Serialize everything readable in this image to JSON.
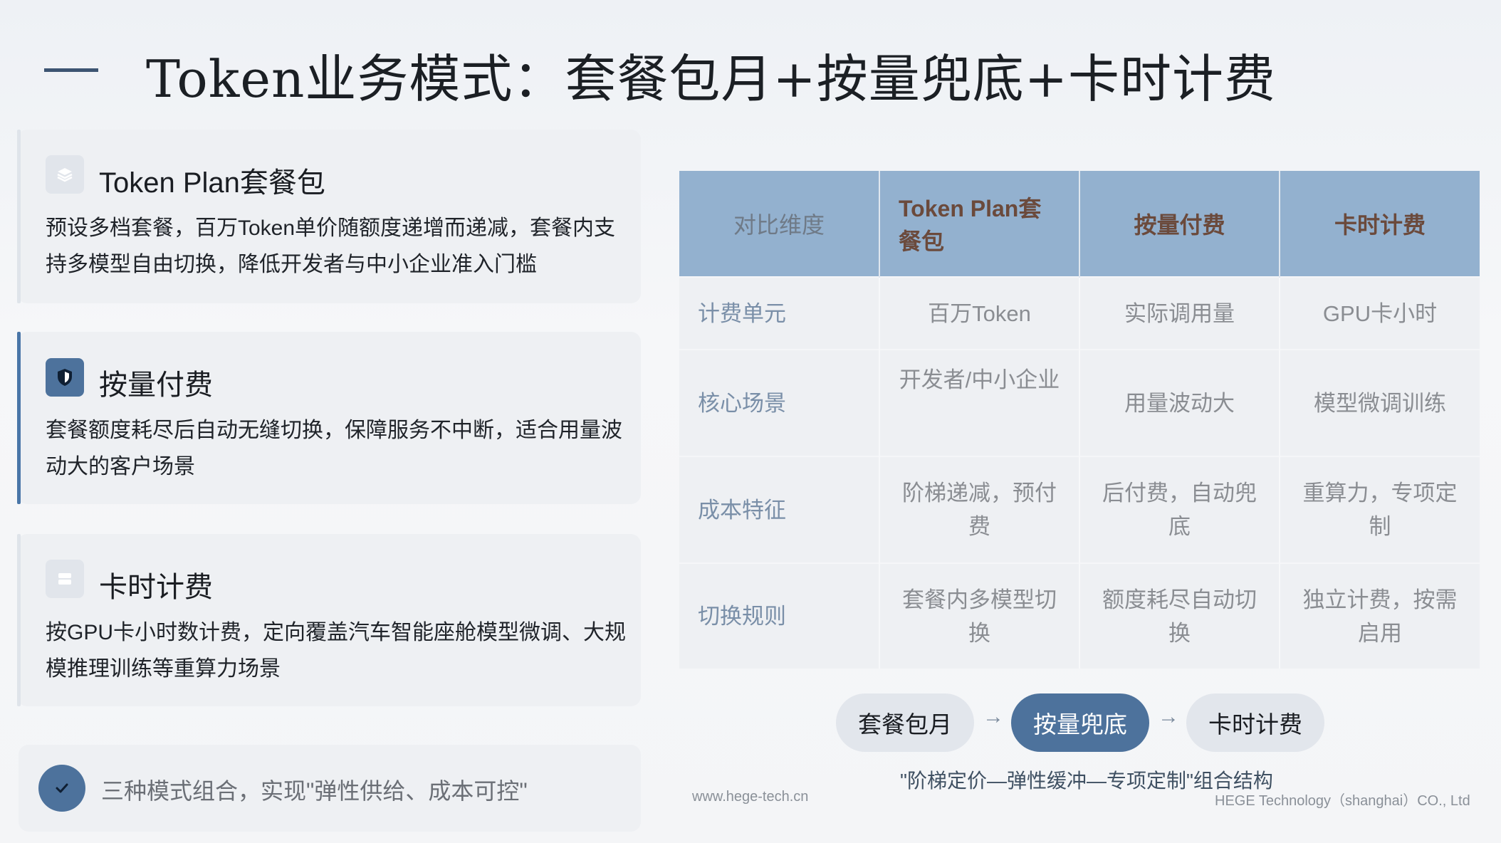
{
  "title": "Token业务模式：套餐包月+按量兜底+卡时计费",
  "cards": [
    {
      "heading": "Token Plan套餐包",
      "body": "预设多档套餐，百万Token单价随额度递增而递减，套餐内支持多模型自由切换，降低开发者与中小企业准入门槛",
      "icon": "layers-icon"
    },
    {
      "heading": "按量付费",
      "body": "套餐额度耗尽后自动无缝切换，保障服务不中断，适合用量波动大的客户场景",
      "icon": "shield-icon"
    },
    {
      "heading": "卡时计费",
      "body": "按GPU卡小时数计费，定向覆盖汽车智能座舱模型微调、大规模推理训练等重算力场景",
      "icon": "server-icon"
    }
  ],
  "summary": {
    "text": "三种模式组合，实现\"弹性供给、成本可控\"",
    "icon": "check-icon"
  },
  "table": {
    "headers": [
      "对比维度",
      "Token Plan套餐包",
      "按量付费",
      "卡时计费"
    ],
    "rows": [
      [
        "计费单元",
        "百万Token",
        "实际调用量",
        "GPU卡小时"
      ],
      [
        "核心场景",
        "开发者/中小企业",
        "用量波动大",
        "模型微调训练"
      ],
      [
        "成本特征",
        "阶梯递减，预付费",
        "后付费，自动兜底",
        "重算力，专项定制"
      ],
      [
        "切换规则",
        "套餐内多模型切换",
        "额度耗尽自动切换",
        "独立计费，按需启用"
      ]
    ]
  },
  "flow": {
    "steps": [
      "套餐包月",
      "按量兜底",
      "卡时计费"
    ],
    "arrow": "→"
  },
  "caption": "\"阶梯定价—弹性缓冲—专项定制\"组合结构",
  "footer": {
    "left": "www.hege-tech.cn",
    "right": "HEGE Technology（shanghai）CO., Ltd"
  },
  "colors": {
    "accent": "#4d729c",
    "header": "#93b1cf",
    "header_text": "#6b4a3c"
  }
}
